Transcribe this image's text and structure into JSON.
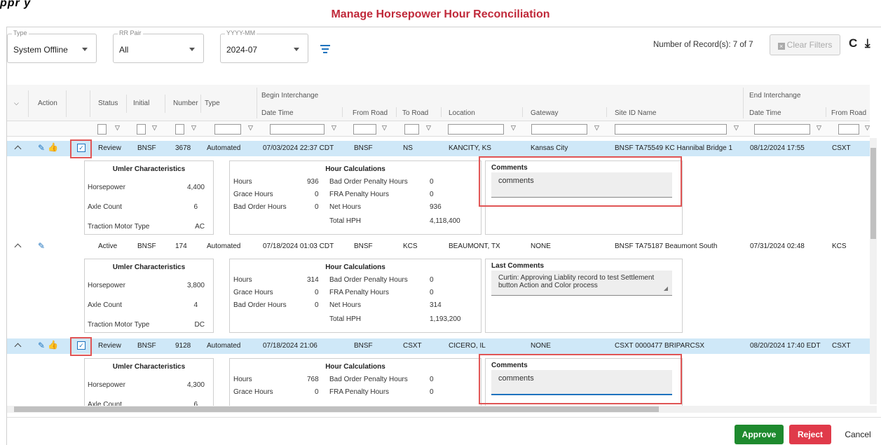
{
  "banner": {
    "fragment": "ppr  y"
  },
  "title": "Manage Horsepower Hour Reconciliation",
  "filters": [
    {
      "legend": "Type",
      "value": "System Offline"
    },
    {
      "legend": "RR Pair",
      "value": "All"
    },
    {
      "legend": "YYYY-MM",
      "value": "2024-07"
    }
  ],
  "toolbar": {
    "record_count": "Number of Record(s): 7 of 7",
    "clear_filters": "Clear Filters",
    "refresh_glyph": "C",
    "download_glyph": "⤓"
  },
  "columns": {
    "action": "Action",
    "status": "Status",
    "initial": "Initial",
    "number": "Number",
    "type": "Type",
    "begin_group": "Begin Interchange",
    "end_group": "End Interchange",
    "date_time": "Date Time",
    "from_road": "From Road",
    "to_road": "To Road",
    "location": "Location",
    "gateway": "Gateway",
    "site_id": "Site ID Name",
    "end_date_time": "Date Time",
    "end_from_road": "From Road"
  },
  "rows": [
    {
      "status": "Review",
      "initial": "BNSF",
      "number": "3678",
      "type": "Automated",
      "begin_dt": "07/03/2024 22:37 CDT",
      "from_road": "BNSF",
      "to_road": "NS",
      "location": "KANCITY, KS",
      "gateway": "Kansas City",
      "site": "BNSF TA75549 KC Hannibal Bridge 1",
      "end_dt": "08/12/2024 17:55",
      "end_from": "CSXT",
      "umler": {
        "horsepower": "4,400",
        "axle_count": "6",
        "traction": "AC"
      },
      "hours": {
        "hours": "936",
        "grace": "0",
        "bad_order": "0",
        "bad_order_penalty": "0",
        "fra_penalty": "0",
        "net": "936",
        "total": "4,118,400"
      },
      "comments_title": "Comments",
      "comments": "comments"
    },
    {
      "status": "Active",
      "initial": "BNSF",
      "number": "174",
      "type": "Automated",
      "begin_dt": "07/18/2024 01:03 CDT",
      "from_road": "BNSF",
      "to_road": "KCS",
      "location": "BEAUMONT, TX",
      "gateway": "NONE",
      "site": "BNSF TA75187 Beaumont South",
      "end_dt": "07/31/2024 02:48",
      "end_from": "KCS",
      "umler": {
        "horsepower": "3,800",
        "axle_count": "4",
        "traction": "DC"
      },
      "hours": {
        "hours": "314",
        "grace": "0",
        "bad_order": "0",
        "bad_order_penalty": "0",
        "fra_penalty": "0",
        "net": "314",
        "total": "1,193,200"
      },
      "comments_title": "Last Comments",
      "comments": "Curtin: Approving Liablity record to test Settlement button Action and Color process"
    },
    {
      "status": "Review",
      "initial": "BNSF",
      "number": "9128",
      "type": "Automated",
      "begin_dt": "07/18/2024 21:06",
      "from_road": "BNSF",
      "to_road": "CSXT",
      "location": "CICERO, IL",
      "gateway": "NONE",
      "site": "CSXT 0000477 BRIPARCSX",
      "end_dt": "08/20/2024 17:40 EDT",
      "end_from": "CSXT",
      "umler": {
        "horsepower": "4,300",
        "axle_count": "6",
        "traction": ""
      },
      "hours": {
        "hours": "768",
        "grace": "0",
        "bad_order": "",
        "bad_order_penalty": "0",
        "fra_penalty": "0",
        "net": "",
        "total": ""
      },
      "comments_title": "Comments",
      "comments": "comments"
    }
  ],
  "labels": {
    "umler_title": "Umler Characteristics",
    "horsepower": "Horsepower",
    "axle_count": "Axle Count",
    "traction": "Traction Motor Type",
    "hour_title": "Hour Calculations",
    "hours": "Hours",
    "grace": "Grace Hours",
    "bad_order": "Bad Order Hours",
    "bad_order_penalty": "Bad Order Penalty Hours",
    "fra_penalty": "FRA Penalty Hours",
    "net": "Net Hours",
    "total": "Total HPH"
  },
  "buttons": {
    "approve": "Approve",
    "reject": "Reject",
    "cancel": "Cancel"
  },
  "colors": {
    "title": "#c0293a",
    "selected_row": "#cfe8f8",
    "approve": "#1e8a2e",
    "reject": "#e03a4a",
    "accent": "#1e73be",
    "highlight_outline": "#e05555"
  },
  "icons": [
    "edit-icon",
    "thumbs-up-icon",
    "filter-icon",
    "refresh-icon",
    "download-icon",
    "chevron-down-icon",
    "collapse-icon"
  ]
}
